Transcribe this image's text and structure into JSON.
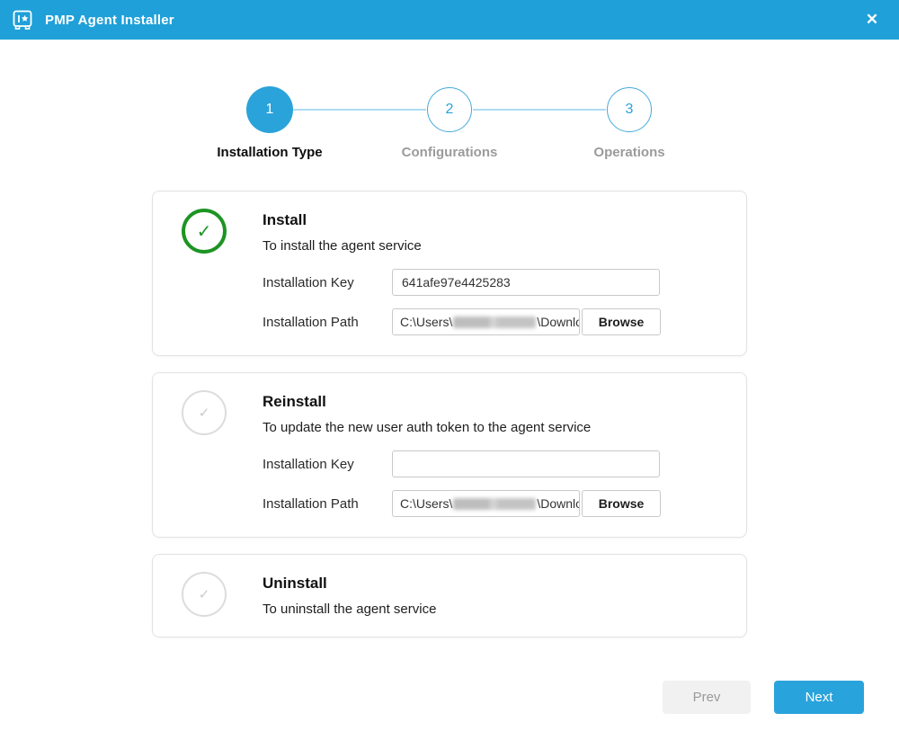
{
  "titlebar": {
    "title": "PMP Agent Installer",
    "close_icon": "✕"
  },
  "stepper": {
    "active_step": 1,
    "steps": [
      {
        "number": "1",
        "label": "Installation Type"
      },
      {
        "number": "2",
        "label": "Configurations"
      },
      {
        "number": "3",
        "label": "Operations"
      }
    ]
  },
  "cards": [
    {
      "title": "Install",
      "description": "To install the agent service",
      "selected": true,
      "check_icon": "✓",
      "key_label": "Installation Key",
      "key_value": "641afe97e4425283",
      "path_label": "Installation Path",
      "path_prefix": "C:\\Users\\",
      "path_redacted": "[redacted]",
      "path_suffix": "\\Downlo",
      "browse_label": "Browse"
    },
    {
      "title": "Reinstall",
      "description": "To update the new user auth token to the agent service",
      "selected": false,
      "check_icon": "✓",
      "key_label": "Installation Key",
      "key_value": "",
      "path_label": "Installation Path",
      "path_prefix": "C:\\Users\\",
      "path_redacted": "[redacted]",
      "path_suffix": "\\Downlo",
      "browse_label": "Browse"
    },
    {
      "title": "Uninstall",
      "description": "To uninstall the agent service",
      "selected": false,
      "check_icon": "✓"
    }
  ],
  "footer": {
    "prev_label": "Prev",
    "next_label": "Next"
  },
  "colors": {
    "titlebar_blue": "#1FA0D8",
    "primary_blue": "#29A3DB",
    "step_line_blue": "#AEDCF2",
    "selected_green": "#1D9424",
    "inactive_gray": "#DCDCDC"
  }
}
